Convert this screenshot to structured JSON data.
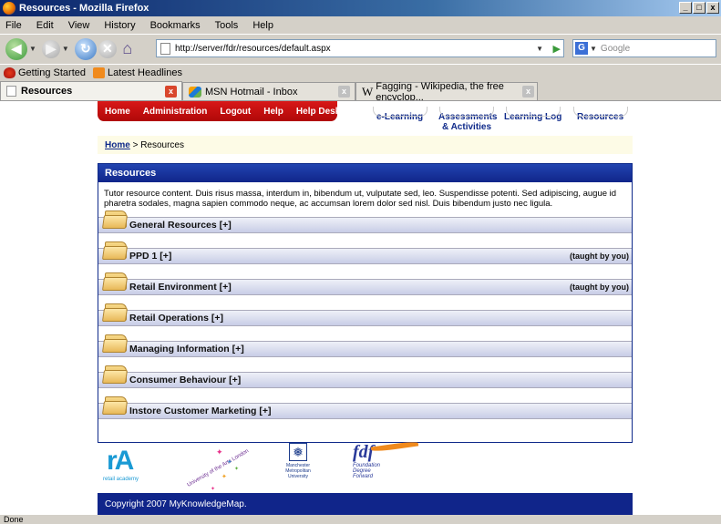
{
  "window": {
    "title": "Resources - Mozilla Firefox",
    "buttons": [
      "_",
      "□",
      "x"
    ]
  },
  "menu": [
    "File",
    "Edit",
    "View",
    "History",
    "Bookmarks",
    "Tools",
    "Help"
  ],
  "address": {
    "url": "http://server/fdr/resources/default.aspx",
    "search_placeholder": "Google"
  },
  "bookmarks": [
    "Getting Started",
    "Latest Headlines"
  ],
  "tabs": [
    {
      "label": "Resources",
      "active": true
    },
    {
      "label": "MSN Hotmail - Inbox",
      "active": false
    },
    {
      "label": "Fagging - Wikipedia, the free encyclop...",
      "active": false
    }
  ],
  "site_nav": {
    "links": [
      "Home",
      "Administration",
      "Logout",
      "Help",
      "Help Desk"
    ],
    "tabs": [
      "e-Learning",
      "Assessments & Activities",
      "Learning Log",
      "Resources"
    ]
  },
  "breadcrumb": {
    "home": "Home",
    "current": " > Resources"
  },
  "panel": {
    "title": "Resources",
    "description": "Tutor resource content. Duis risus massa, interdum in, bibendum ut, vulputate sed, leo. Suspendisse potenti. Sed adipiscing, augue id pharetra sodales, magna sapien commodo neque, ac accumsan lorem dolor sed nisl. Duis bibendum justo nec ligula.",
    "sections": [
      {
        "name": "General Resources [+]",
        "note": ""
      },
      {
        "name": "PPD 1 [+]",
        "note": "(taught by you)"
      },
      {
        "name": "Retail Environment [+]",
        "note": "(taught by you)"
      },
      {
        "name": "Retail Operations [+]",
        "note": ""
      },
      {
        "name": "Managing Information [+]",
        "note": ""
      },
      {
        "name": "Consumer Behaviour [+]",
        "note": ""
      },
      {
        "name": "Instore Customer Marketing [+]",
        "note": ""
      }
    ]
  },
  "logos": {
    "ra_mark": "rA",
    "ra_text": "retail academy",
    "ual_text": "University of the Arts London",
    "mmu_text": "Manchester Metropolitan University",
    "fdf_mark": "fdf",
    "fdf_sub": "Foundation Degree Forward"
  },
  "footer": "Copyright 2007 MyKnowledgeMap.",
  "status": "Done"
}
